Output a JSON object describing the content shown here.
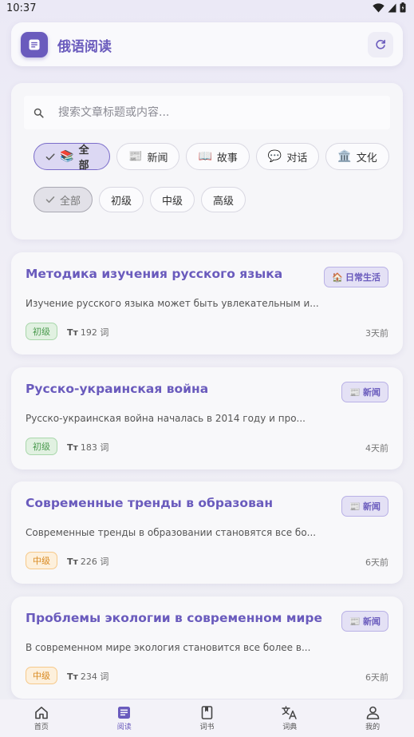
{
  "status_bar": {
    "time": "10:37"
  },
  "header": {
    "title": "俄语阅读"
  },
  "search": {
    "placeholder": "搜索文章标题或内容..."
  },
  "categories": [
    {
      "label": "全部",
      "emoji": "📚",
      "selected": true
    },
    {
      "label": "新闻",
      "emoji": "📰",
      "selected": false
    },
    {
      "label": "故事",
      "emoji": "📖",
      "selected": false
    },
    {
      "label": "对话",
      "emoji": "💬",
      "selected": false
    },
    {
      "label": "文化",
      "emoji": "🏛️",
      "selected": false
    }
  ],
  "levels": [
    {
      "label": "全部",
      "selected": true
    },
    {
      "label": "初级",
      "selected": false
    },
    {
      "label": "中级",
      "selected": false
    },
    {
      "label": "高级",
      "selected": false
    }
  ],
  "articles": [
    {
      "title": "Методика изучения русского языка",
      "tag": "日常生活",
      "tag_emoji": "🏠",
      "excerpt": "Изучение русского языка может быть увлекательным и...",
      "level": "初级",
      "word_count": "192 词",
      "date": "3天前"
    },
    {
      "title": "Русско-украинская война",
      "tag": "新闻",
      "tag_emoji": "📰",
      "excerpt": "Русско-украинская война началась в 2014 году и про...",
      "level": "初级",
      "word_count": "183 词",
      "date": "4天前"
    },
    {
      "title": "Современные тренды в образован",
      "tag": "新闻",
      "tag_emoji": "📰",
      "excerpt": "Современные тренды в образовании становятся все бо...",
      "level": "中级",
      "word_count": "226 词",
      "date": "6天前"
    },
    {
      "title": "Проблемы экологии в современном мире",
      "tag": "新闻",
      "tag_emoji": "📰",
      "excerpt": "В современном мире экология становится все более в...",
      "level": "中级",
      "word_count": "234 词",
      "date": "6天前"
    }
  ],
  "bottom_nav": [
    {
      "label": "首页",
      "icon": "home-icon",
      "active": false
    },
    {
      "label": "阅读",
      "icon": "document-icon",
      "active": true
    },
    {
      "label": "词书",
      "icon": "book-icon",
      "active": false
    },
    {
      "label": "词典",
      "icon": "translate-icon",
      "active": false
    },
    {
      "label": "我的",
      "icon": "person-icon",
      "active": false
    }
  ],
  "colors": {
    "accent": "#6a5bbd",
    "beginner": "#4a9a4e",
    "intermediate": "#d98a22"
  }
}
